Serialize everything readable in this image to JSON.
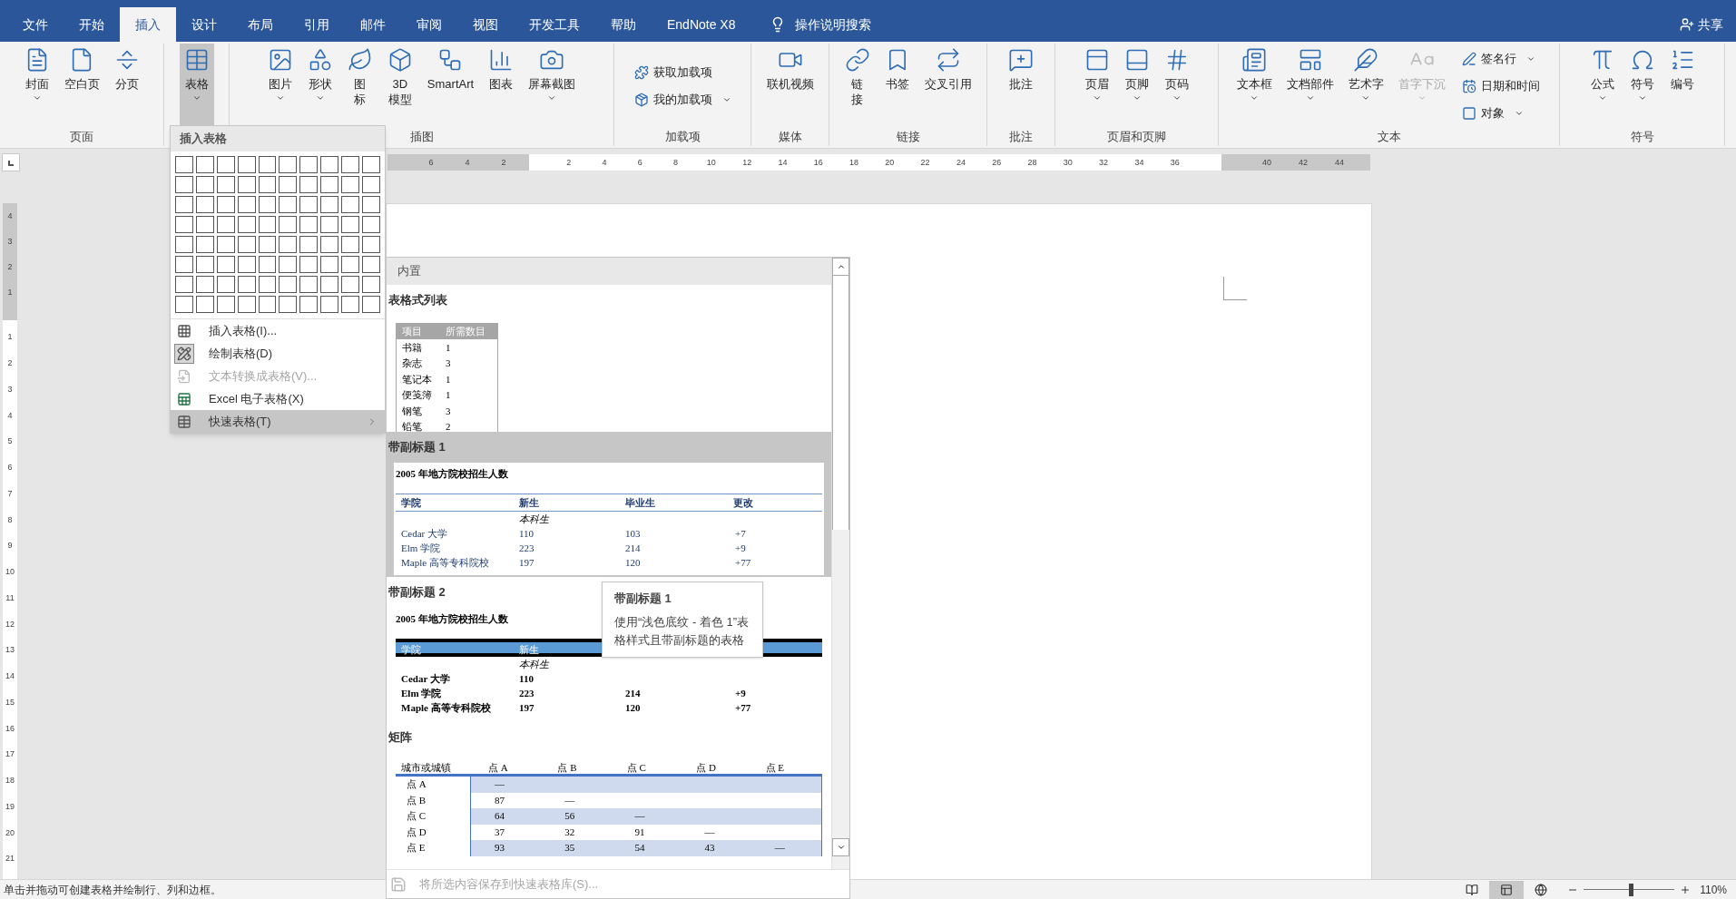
{
  "tabs": [
    {
      "label": "文件",
      "selected": false
    },
    {
      "label": "开始",
      "selected": false
    },
    {
      "label": "插入",
      "selected": true
    },
    {
      "label": "设计",
      "selected": false
    },
    {
      "label": "布局",
      "selected": false
    },
    {
      "label": "引用",
      "selected": false
    },
    {
      "label": "邮件",
      "selected": false
    },
    {
      "label": "审阅",
      "selected": false
    },
    {
      "label": "视图",
      "selected": false
    },
    {
      "label": "开发工具",
      "selected": false
    },
    {
      "label": "帮助",
      "selected": false
    },
    {
      "label": "EndNote X8",
      "selected": false
    }
  ],
  "tell_me": {
    "label": "操作说明搜索"
  },
  "share": {
    "label": "共享"
  },
  "ribbon": {
    "groups": [
      {
        "label": "页面",
        "buttons": [
          {
            "kind": "large",
            "lines": [
              "封面"
            ],
            "dropdown": true,
            "pressed": false,
            "disabled": false
          },
          {
            "kind": "large",
            "lines": [
              "空白页"
            ],
            "dropdown": false,
            "pressed": false,
            "disabled": false
          },
          {
            "kind": "large",
            "lines": [
              "分页"
            ],
            "dropdown": false,
            "pressed": false,
            "disabled": false
          }
        ]
      },
      {
        "buttons": [
          {
            "kind": "large",
            "lines": [
              "表格"
            ],
            "dropdown": true,
            "pressed": true,
            "disabled": false
          }
        ]
      },
      {
        "label": "插图",
        "buttons": [
          {
            "kind": "large",
            "lines": [
              "图片"
            ],
            "dropdown": true,
            "pressed": false,
            "disabled": false
          },
          {
            "kind": "large",
            "lines": [
              "形状"
            ],
            "dropdown": true,
            "pressed": false,
            "disabled": false
          },
          {
            "kind": "large",
            "lines": [
              "图",
              "标"
            ],
            "dropdown": false,
            "pressed": false,
            "disabled": false
          },
          {
            "kind": "large",
            "lines": [
              "3D",
              "模型"
            ],
            "dropdown": false,
            "pressed": false,
            "disabled": false
          },
          {
            "kind": "large",
            "lines": [
              "SmartArt"
            ],
            "dropdown": false,
            "pressed": false,
            "disabled": false
          },
          {
            "kind": "large",
            "lines": [
              "图表"
            ],
            "dropdown": false,
            "pressed": false,
            "disabled": false
          },
          {
            "kind": "large",
            "lines": [
              "屏幕截图"
            ],
            "dropdown": true,
            "pressed": false,
            "disabled": false
          }
        ]
      },
      {
        "label": "加载项",
        "buttons": [
          {
            "kind": "small",
            "lines": [
              "获取加载项"
            ],
            "dropdown": false,
            "pressed": false,
            "disabled": false
          },
          {
            "kind": "small",
            "lines": [
              "我的加载项"
            ],
            "dropdown": true,
            "pressed": false,
            "disabled": false
          }
        ]
      },
      {
        "label": "媒体",
        "buttons": [
          {
            "kind": "large",
            "lines": [
              "联机视频"
            ],
            "dropdown": false,
            "pressed": false,
            "disabled": false
          }
        ]
      },
      {
        "label": "链接",
        "buttons": [
          {
            "kind": "large",
            "lines": [
              "链",
              "接"
            ],
            "dropdown": false,
            "pressed": false,
            "disabled": false
          },
          {
            "kind": "large",
            "lines": [
              "书签"
            ],
            "dropdown": false,
            "pressed": false,
            "disabled": false
          },
          {
            "kind": "large",
            "lines": [
              "交叉引用"
            ],
            "dropdown": false,
            "pressed": false,
            "disabled": false
          }
        ]
      },
      {
        "label": "批注",
        "buttons": [
          {
            "kind": "large",
            "lines": [
              "批注"
            ],
            "dropdown": false,
            "pressed": false,
            "disabled": false
          }
        ]
      },
      {
        "label": "页眉和页脚",
        "buttons": [
          {
            "kind": "large",
            "lines": [
              "页眉"
            ],
            "dropdown": true,
            "pressed": false,
            "disabled": false
          },
          {
            "kind": "large",
            "lines": [
              "页脚"
            ],
            "dropdown": true,
            "pressed": false,
            "disabled": false
          },
          {
            "kind": "large",
            "lines": [
              "页码"
            ],
            "dropdown": true,
            "pressed": false,
            "disabled": false
          }
        ]
      },
      {
        "label": "文本",
        "buttons": [
          {
            "kind": "large",
            "lines": [
              "文本框"
            ],
            "dropdown": true,
            "pressed": false,
            "disabled": false
          },
          {
            "kind": "large",
            "lines": [
              "文档部件"
            ],
            "dropdown": true,
            "pressed": false,
            "disabled": false
          },
          {
            "kind": "large",
            "lines": [
              "艺术字"
            ],
            "dropdown": true,
            "pressed": false,
            "disabled": false
          },
          {
            "kind": "large",
            "lines": [
              "首字下沉"
            ],
            "dropdown": true,
            "pressed": false,
            "disabled": true
          },
          {
            "kind": "small",
            "lines": [
              "签名行"
            ],
            "dropdown": true,
            "pressed": false,
            "disabled": false
          },
          {
            "kind": "small",
            "lines": [
              "日期和时间"
            ],
            "dropdown": false,
            "pressed": false,
            "disabled": false
          },
          {
            "kind": "small",
            "lines": [
              "对象"
            ],
            "dropdown": true,
            "pressed": false,
            "disabled": false
          }
        ]
      },
      {
        "label": "符号",
        "buttons": [
          {
            "kind": "large",
            "lines": [
              "公式"
            ],
            "dropdown": true,
            "pressed": false,
            "disabled": false
          },
          {
            "kind": "large",
            "lines": [
              "符号"
            ],
            "dropdown": true,
            "pressed": false,
            "disabled": false
          },
          {
            "kind": "large",
            "lines": [
              "编号"
            ],
            "dropdown": false,
            "pressed": false,
            "disabled": false
          }
        ]
      }
    ]
  },
  "ruler": {
    "left_labels": [
      "6",
      "4",
      "2"
    ],
    "main_labels": [
      "2",
      "4",
      "6",
      "8",
      "10",
      "12",
      "14",
      "16",
      "18",
      "20",
      "22",
      "24",
      "26",
      "28",
      "30",
      "32",
      "34",
      "36"
    ],
    "right_labels": [
      "40",
      "42",
      "44"
    ],
    "vertical_margin_labels": [
      "4",
      "3",
      "2",
      "1"
    ],
    "vertical_labels": [
      "1",
      "2",
      "3",
      "4",
      "5",
      "6",
      "7",
      "8",
      "9",
      "10",
      "11",
      "12",
      "13",
      "14",
      "15",
      "16",
      "17",
      "18",
      "19",
      "20",
      "21"
    ]
  },
  "table_menu": {
    "title": "插入表格",
    "items": [
      {
        "label": "插入表格(I)...",
        "checked": false,
        "disabled": false,
        "selected": false,
        "submenu": false
      },
      {
        "label": "绘制表格(D)",
        "checked": true,
        "disabled": false,
        "selected": false,
        "submenu": false
      },
      {
        "label": "文本转换成表格(V)...",
        "checked": false,
        "disabled": true,
        "selected": false,
        "submenu": false
      },
      {
        "label": "Excel 电子表格(X)",
        "checked": false,
        "disabled": false,
        "selected": false,
        "submenu": false
      },
      {
        "label": "快速表格(T)",
        "checked": false,
        "disabled": false,
        "selected": true,
        "submenu": true
      }
    ]
  },
  "quick_tables": {
    "header": "内置",
    "sections": [
      {
        "title": "表格式列表",
        "selected": false,
        "kind": "list",
        "columns": [
          "项目",
          "所需数目"
        ],
        "rows": [
          [
            "书籍",
            "1"
          ],
          [
            "杂志",
            "3"
          ],
          [
            "笔记本",
            "1"
          ],
          [
            "便笺簿",
            "1"
          ],
          [
            "钢笔",
            "3"
          ],
          [
            "铅笔",
            "2"
          ]
        ]
      },
      {
        "title": "带副标题 1",
        "selected": true,
        "kind": "subheading1",
        "caption": "2005 年地方院校招生人数",
        "columns": [
          "学院",
          "新生",
          "毕业生",
          "更改"
        ],
        "subheading": "本科生",
        "rows": [
          [
            "Cedar 大学",
            "110",
            "103",
            "+7"
          ],
          [
            "Elm  学院",
            "223",
            "214",
            "+9"
          ],
          [
            "Maple 高等专科院校",
            "197",
            "120",
            "+77"
          ]
        ]
      },
      {
        "title": "带副标题 2",
        "selected": false,
        "kind": "subheading2",
        "caption": "2005 年地方院校招生人数",
        "columns": [
          "学院",
          "新生"
        ],
        "subheading": "本科生",
        "rows": [
          [
            "Cedar 大学",
            "110"
          ],
          [
            "Elm  学院",
            "223",
            "214",
            "+9"
          ],
          [
            "Maple 高等专科院校",
            "197",
            "120",
            "+77"
          ]
        ]
      },
      {
        "title": "矩阵",
        "selected": false,
        "kind": "matrix",
        "columns": [
          "城市或城镇",
          "点 A",
          "点 B",
          "点 C",
          "点 D",
          "点 E"
        ],
        "rows": [
          [
            "点 A",
            "—"
          ],
          [
            "点 B",
            "87",
            "—"
          ],
          [
            "点 C",
            "64",
            "56",
            "—"
          ],
          [
            "点 D",
            "37",
            "32",
            "91",
            "—"
          ],
          [
            "点 E",
            "93",
            "35",
            "54",
            "43",
            "—"
          ]
        ]
      }
    ],
    "footer": {
      "label": "将所选内容保存到快速表格库(S)...",
      "disabled": true
    }
  },
  "tooltip": {
    "title": "带副标题 1",
    "body": "使用“浅色底纹 - 着色 1”表格样式且带副标题的表格"
  },
  "status_bar": {
    "message": "单击并拖动可创建表格并绘制行、列和边框。",
    "views": [
      {
        "selected": false
      },
      {
        "selected": true
      },
      {
        "selected": false
      }
    ],
    "zoom": {
      "level": 0.52,
      "reading": "110%"
    }
  }
}
